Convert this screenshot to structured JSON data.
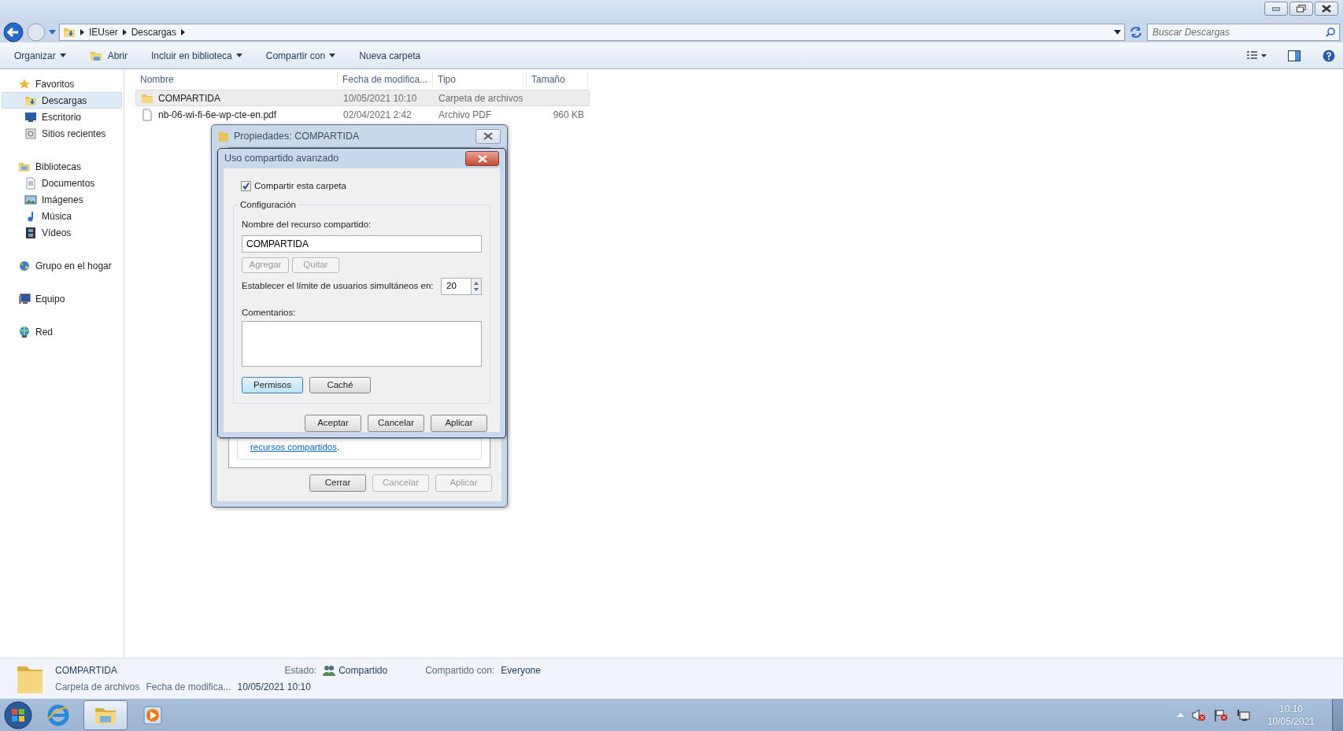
{
  "address": {
    "crumbs": [
      "IEUser",
      "Descargas"
    ],
    "search_placeholder": "Buscar Descargas"
  },
  "toolbar": [
    {
      "label": "Organizar",
      "kind": "menu"
    },
    {
      "label": "Abrir",
      "kind": "open"
    },
    {
      "label": "Incluir en biblioteca",
      "kind": "menu"
    },
    {
      "label": "Compartir con",
      "kind": "menu"
    },
    {
      "label": "Nueva carpeta",
      "kind": "plain"
    }
  ],
  "sidebar": [
    {
      "label": "Favoritos",
      "kind": "star",
      "selected": false,
      "children": [
        {
          "label": "Descargas",
          "kind": "downloads",
          "selected": true
        },
        {
          "label": "Escritorio",
          "kind": "desktop",
          "selected": false
        },
        {
          "label": "Sitios recientes",
          "kind": "recent",
          "selected": false
        }
      ]
    },
    {
      "label": "Bibliotecas",
      "kind": "library",
      "selected": false,
      "children": [
        {
          "label": "Documentos",
          "kind": "documents",
          "selected": false
        },
        {
          "label": "Imágenes",
          "kind": "pictures",
          "selected": false
        },
        {
          "label": "Música",
          "kind": "music",
          "selected": false
        },
        {
          "label": "Vídeos",
          "kind": "videos",
          "selected": false
        }
      ]
    },
    {
      "label": "Grupo en el hogar",
      "kind": "homegroup",
      "selected": false
    },
    {
      "label": "Equipo",
      "kind": "computer",
      "selected": false
    },
    {
      "label": "Red",
      "kind": "network",
      "selected": false
    }
  ],
  "file_list": {
    "columns": [
      "Nombre",
      "Fecha de modifica...",
      "Tipo",
      "Tamaño"
    ],
    "rows": [
      {
        "kind": "folder",
        "name": "COMPARTIDA",
        "date": "10/05/2021 10:10",
        "type": "Carpeta de archivos",
        "selected": true
      },
      {
        "kind": "file",
        "name": "nb-06-wi-fi-6e-wp-cte-en.pdf",
        "date": "02/04/2021 2:42",
        "type": "Archivo PDF",
        "size": "960 KB",
        "selected": false
      }
    ]
  },
  "properties_dialog": {
    "title": "Propiedades: COMPARTIDA",
    "link": "recursos compartidos",
    "link_end": ".",
    "buttons": [
      {
        "label": "Cerrar",
        "disabled": false
      },
      {
        "label": "Cancelar",
        "disabled": true
      },
      {
        "label": "Aplicar",
        "disabled": true
      }
    ]
  },
  "advanced_dialog": {
    "title": "Uso compartido avanzado",
    "share_checkbox": {
      "label": "Compartir esta carpeta",
      "checked": true
    },
    "group_title": "Configuración",
    "share_name_label": "Nombre del recurso compartido:",
    "share_name": "COMPARTIDA",
    "name_buttons": [
      {
        "label": "Agregar",
        "disabled": true
      },
      {
        "label": "Quitar",
        "disabled": true
      }
    ],
    "limit_label": "Establecer el límite de usuarios simultáneos en:",
    "limit": "20",
    "comments_label": "Comentarios:",
    "action_buttons": [
      {
        "label": "Permisos",
        "focused": true
      },
      {
        "label": "Caché",
        "focused": false
      }
    ],
    "buttons": [
      {
        "label": "Aceptar",
        "disabled": false
      },
      {
        "label": "Cancelar",
        "disabled": false
      },
      {
        "label": "Aplicar",
        "disabled": false
      }
    ]
  },
  "details_pane": {
    "name": "COMPARTIDA",
    "type": "Carpeta de archivos",
    "state_label": "Estado:",
    "state": "Compartido",
    "date_label": "Fecha de modifica...",
    "date": "10/05/2021 10:10",
    "shared_label": "Compartido con:",
    "shared_with": "Everyone"
  },
  "taskbar": {
    "apps": [
      {
        "kind": "browser",
        "selected": false
      },
      {
        "kind": "explorer",
        "selected": true
      },
      {
        "kind": "media",
        "selected": false
      }
    ],
    "time": "10:10",
    "date": "10/05/2021"
  }
}
